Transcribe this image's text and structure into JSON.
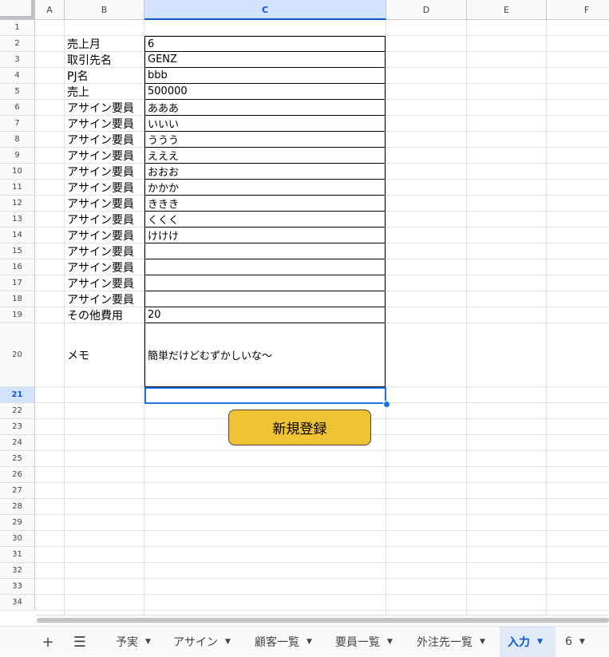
{
  "columns": [
    "A",
    "B",
    "C",
    "D",
    "E",
    "F"
  ],
  "selected_column": "C",
  "rows": [
    "1",
    "2",
    "3",
    "4",
    "5",
    "6",
    "7",
    "8",
    "9",
    "10",
    "11",
    "12",
    "13",
    "14",
    "15",
    "16",
    "17",
    "18",
    "19",
    "20",
    "21",
    "22",
    "23",
    "24",
    "25",
    "26",
    "27",
    "28",
    "29",
    "30",
    "31",
    "32",
    "33",
    "34"
  ],
  "selected_row": "21",
  "form": {
    "labels": [
      "売上月",
      "取引先名",
      "PJ名",
      "売上",
      "アサイン要員",
      "アサイン要員",
      "アサイン要員",
      "アサイン要員",
      "アサイン要員",
      "アサイン要員",
      "アサイン要員",
      "アサイン要員",
      "アサイン要員",
      "アサイン要員",
      "アサイン要員",
      "アサイン要員",
      "アサイン要員",
      "その他費用",
      "メモ"
    ],
    "values": [
      "6",
      "GENZ",
      "bbb",
      "500000",
      "あああ",
      "いいい",
      "ううう",
      "えええ",
      "おおお",
      "かかか",
      "ききき",
      "くくく",
      "けけけ",
      "",
      "",
      "",
      "",
      "20",
      "簡単だけどむずかしいな～"
    ]
  },
  "register_button": "新規登録",
  "sheet_tabs": {
    "items": [
      "予実",
      "アサイン",
      "顧客一覧",
      "要員一覧",
      "外注先一覧",
      "入力",
      "6"
    ],
    "active": "入力"
  },
  "icons": {
    "add_sheet": "plus-icon",
    "all_sheets": "menu-icon",
    "tab_menu": "caret-down-icon"
  },
  "colors": {
    "accent": "#0b57d0",
    "selection": "#1a73e8",
    "button": "#f1c232"
  }
}
